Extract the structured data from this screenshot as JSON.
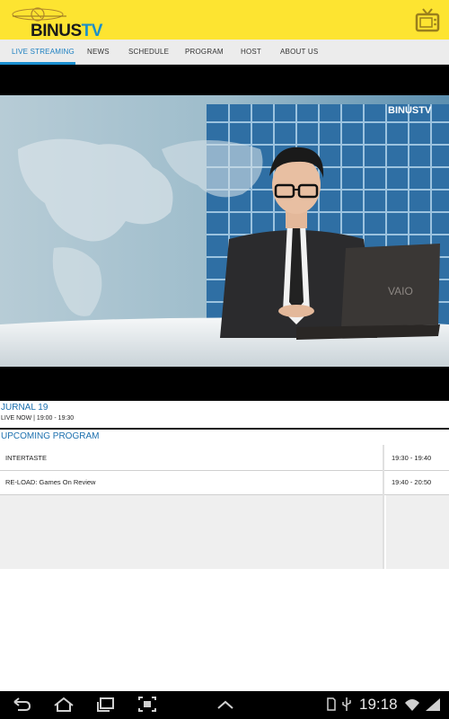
{
  "app": {
    "brand_prefix": "BINUS",
    "brand_suffix": "TV"
  },
  "tabs": [
    {
      "label": "LIVE STREAMING"
    },
    {
      "label": "NEWS"
    },
    {
      "label": "SCHEDULE"
    },
    {
      "label": "PROGRAM"
    },
    {
      "label": "HOST"
    },
    {
      "label": "ABOUT US"
    }
  ],
  "video": {
    "watermark": "BINUSTV",
    "laptop_brand": "VAIO"
  },
  "now_playing": {
    "title": "JURNAL 19",
    "status": "LIVE NOW | 19:00 - 19:30"
  },
  "upcoming": {
    "heading": "UPCOMING PROGRAM",
    "items": [
      {
        "name": "INTERTASTE",
        "time": "19:30 - 19:40"
      },
      {
        "name": "RE-LOAD: Games On Review",
        "time": "19:40 - 20:50"
      }
    ]
  },
  "system_bar": {
    "time": "19:18",
    "colors": {
      "background": "#000000",
      "icon": "#d0d0d0"
    }
  },
  "colors": {
    "appbar": "#fde431",
    "accent": "#1b7fc1"
  }
}
